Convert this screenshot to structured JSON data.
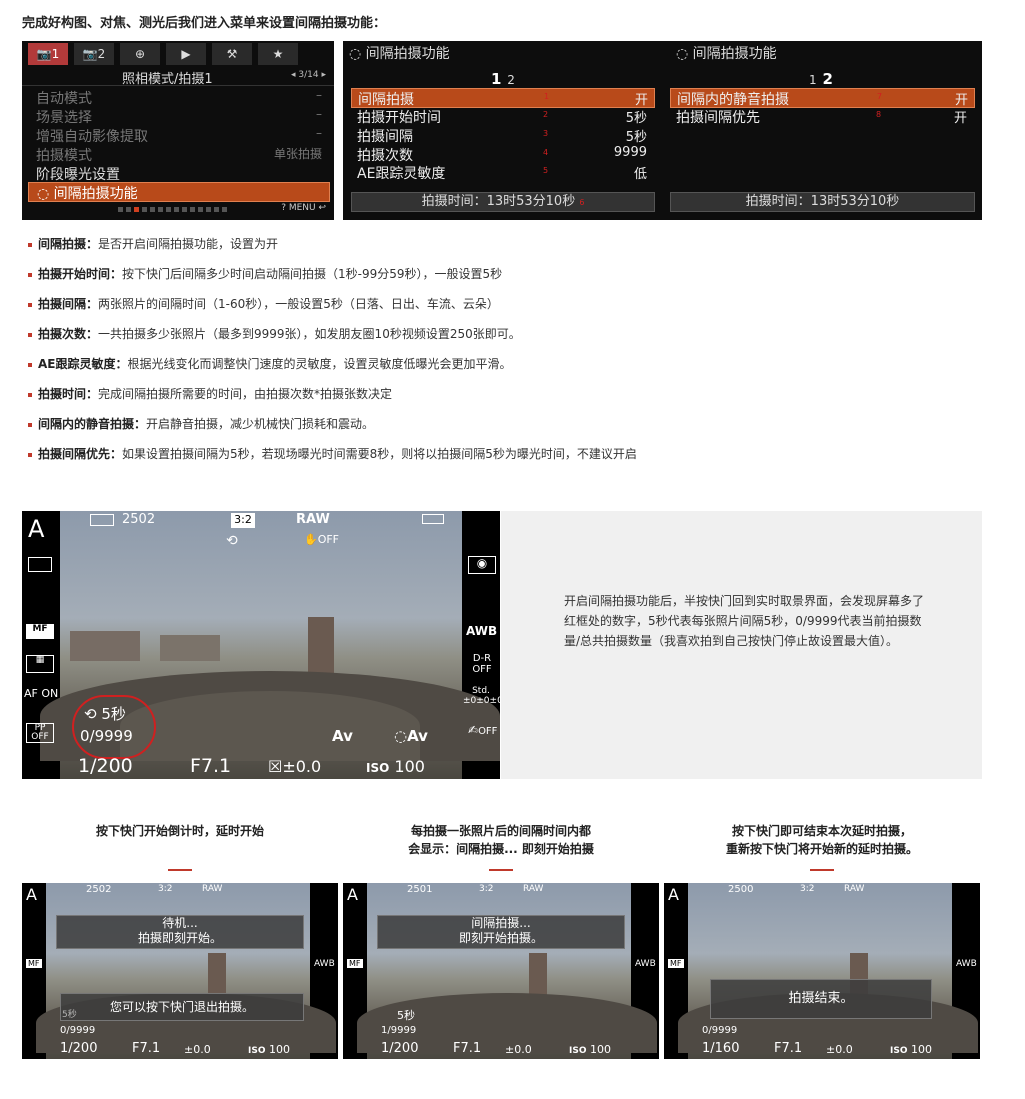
{
  "intro": "完成好构图、对焦、测光后我们进入菜单来设置间隔拍摄功能：",
  "menu1": {
    "tabs": [
      "1",
      "2",
      "",
      "",
      "",
      "★"
    ],
    "title": "照相模式/拍摄1",
    "page": "◂ 3/14 ▸",
    "items": [
      {
        "label": "自动模式",
        "value": "–"
      },
      {
        "label": "场景选择",
        "value": "–"
      },
      {
        "label": "增强自动影像提取",
        "value": "–"
      },
      {
        "label": "拍摄模式",
        "value": "单张拍摄"
      },
      {
        "label": "阶段曝光设置",
        "value": ""
      },
      {
        "label": "◌ 间隔拍摄功能",
        "value": ""
      }
    ],
    "footer": "? MENU ↩"
  },
  "menu2": {
    "left": {
      "header": "◌ 间隔拍摄功能",
      "page_num1": "1",
      "page_num2": "2",
      "items": [
        {
          "label": "间隔拍摄",
          "num": "1",
          "value": "开"
        },
        {
          "label": "拍摄开始时间",
          "num": "2",
          "value": "5秒"
        },
        {
          "label": "拍摄间隔",
          "num": "3",
          "value": "5秒"
        },
        {
          "label": "拍摄次数",
          "num": "4",
          "value": "9999"
        },
        {
          "label": "AE跟踪灵敏度",
          "num": "5",
          "value": "低"
        }
      ],
      "time": "拍摄时间：13时53分10秒",
      "time_num": "6"
    },
    "right": {
      "header": "◌ 间隔拍摄功能",
      "page_num1": "1",
      "page_num2": "2",
      "items": [
        {
          "label": "间隔内的静音拍摄",
          "num": "7",
          "value": "开"
        },
        {
          "label": "拍摄间隔优先",
          "num": "8",
          "value": "开"
        }
      ],
      "time": "拍摄时间：13时53分10秒"
    }
  },
  "bullets": [
    {
      "term": "间隔拍摄：",
      "text": "是否开启间隔拍摄功能，设置为开"
    },
    {
      "term": "拍摄开始时间：",
      "text": "按下快门后间隔多少时间启动隔间拍摄（1秒-99分59秒），一般设置5秒"
    },
    {
      "term": "拍摄间隔：",
      "text": "两张照片的间隔时间（1-60秒），一般设置5秒（日落、日出、车流、云朵）"
    },
    {
      "term": "拍摄次数：",
      "text": "一共拍摄多少张照片（最多到9999张），如发朋友圈10秒视频设置250张即可。"
    },
    {
      "term": "AE跟踪灵敏度：",
      "text": "根据光线变化而调整快门速度的灵敏度，设置灵敏度低曝光会更加平滑。"
    },
    {
      "term": "拍摄时间：",
      "text": "完成间隔拍摄所需要的时间，由拍摄次数*拍摄张数决定"
    },
    {
      "term": "间隔内的静音拍摄：",
      "text": "开启静音拍摄，减少机械快门损耗和震动。"
    },
    {
      "term": "拍摄间隔优先：",
      "text": "如果设置拍摄间隔为5秒，若现场曝光时间需要8秒，则将以拍摄间隔5秒为曝光时间，不建议开启"
    }
  ],
  "bigcam": {
    "mode": "A",
    "shots": "2502",
    "aspect": "3:2",
    "quality": "RAW",
    "left_icons": [
      "MF",
      "▦",
      "AF ON",
      "PP OFF"
    ],
    "right_icons": [
      "AWB",
      "D-R OFF",
      "Std. ±0±0±0",
      "OFF"
    ],
    "interval": "5秒",
    "count": "0/9999",
    "av_left": "Av",
    "av_right": "Av",
    "shutter": "1/200",
    "aperture": "F7.1",
    "ev": "±0.0",
    "iso_label": "ISO",
    "iso": "100"
  },
  "info_text": "开启间隔拍摄功能后，半按快门回到实时取景界面，会发现屏幕多了红框处的数字，5秒代表每张照片间隔5秒，0/9999代表当前拍摄数量/总共拍摄数量（我喜欢拍到自己按快门停止故设置最大值）。",
  "captions": [
    {
      "l1": "按下快门开始倒计时，延时开始",
      "l2": ""
    },
    {
      "l1": "每拍摄一张照片后的间隔时间内都",
      "l2": "会显示：间隔拍摄... 即刻开始拍摄"
    },
    {
      "l1": "按下快门即可结束本次延时拍摄，",
      "l2": "重新按下快门将开始新的延时拍摄。"
    }
  ],
  "smallcams": [
    {
      "shots": "2502",
      "ov1a": "待机...",
      "ov1b": "拍摄即刻开始。",
      "ov2": "您可以按下快门退出拍摄。",
      "interval": "5秒",
      "count": "0/9999",
      "shutter": "1/200",
      "aperture": "F7.1",
      "ev": "±0.0",
      "iso": "100"
    },
    {
      "shots": "2501",
      "ov1a": "间隔拍摄...",
      "ov1b": "即刻开始拍摄。",
      "ov2": "",
      "interval": "5秒",
      "count": "1/9999",
      "shutter": "1/200",
      "aperture": "F7.1",
      "ev": "±0.0",
      "iso": "100"
    },
    {
      "shots": "2500",
      "ov1a": "",
      "ov1b": "",
      "ov2": "拍摄结束。",
      "interval": "",
      "count": "0/9999",
      "shutter": "1/160",
      "aperture": "F7.1",
      "ev": "±0.0",
      "iso": "100"
    }
  ]
}
